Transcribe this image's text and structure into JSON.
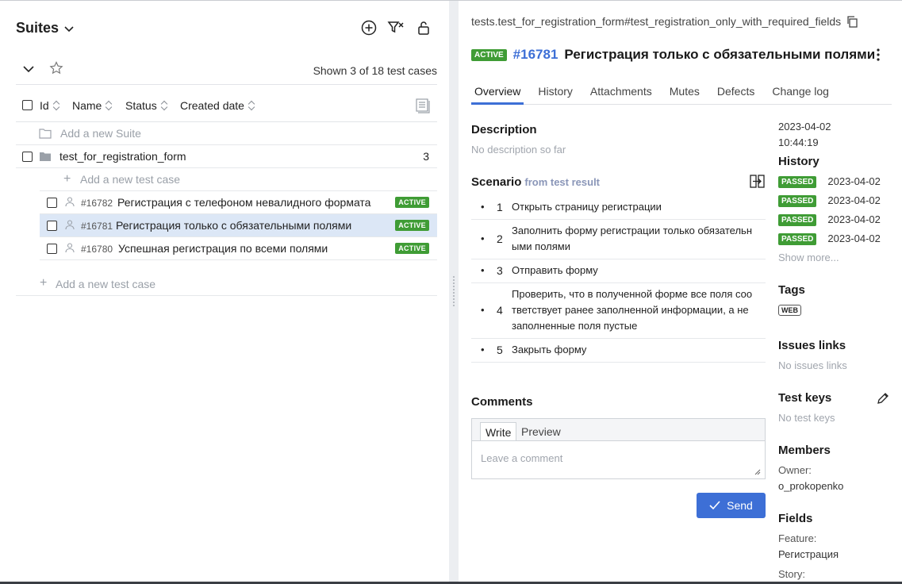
{
  "left": {
    "title": "Suites",
    "shown": "Shown 3 of 18 test cases",
    "columns": {
      "id": "Id",
      "name": "Name",
      "status": "Status",
      "created": "Created date"
    },
    "add_suite": "Add a new Suite",
    "suite": {
      "name": "test_for_registration_form",
      "count": "3"
    },
    "add_case_inner": "Add a new test case",
    "cases": [
      {
        "id": "#16782",
        "name": "Регистрация с телефоном невалидного формата",
        "status": "ACTIVE"
      },
      {
        "id": "#16781",
        "name": "Регистрация только с обязательными полями",
        "status": "ACTIVE"
      },
      {
        "id": "#16780",
        "name": "Успешная регистрация по всеми полями",
        "status": "ACTIVE"
      }
    ],
    "add_case_outer": "Add a new test case"
  },
  "right": {
    "fqn": "tests.test_for_registration_form#test_registration_only_with_required_fields",
    "status": "ACTIVE",
    "id": "#16781",
    "title": "Регистрация только с обязательными полями",
    "tabs": [
      "Overview",
      "History",
      "Attachments",
      "Mutes",
      "Defects",
      "Change log"
    ],
    "description_h": "Description",
    "description": "No description so far",
    "scenario_h": "Scenario",
    "scenario_sub": "from test result",
    "steps": [
      {
        "n": "1",
        "text": "Открыть страницу регистрации"
      },
      {
        "n": "2",
        "text": "Заполнить форму регистрации только обязательн ыми полями"
      },
      {
        "n": "3",
        "text": "Отправить форму"
      },
      {
        "n": "4",
        "text": "Проверить, что в полученной форме все поля соо тветствует ранее заполненной информации, а не заполненные поля пустые"
      },
      {
        "n": "5",
        "text": "Закрыть форму"
      }
    ],
    "comments_h": "Comments",
    "write_tab": "Write",
    "preview_tab": "Preview",
    "comment_placeholder": "Leave a comment",
    "send": "Send",
    "side": {
      "created_date": "2023-04-02",
      "created_time": "10:44:19",
      "history_h": "History",
      "history": [
        {
          "status": "PASSED",
          "date": "2023-04-02"
        },
        {
          "status": "PASSED",
          "date": "2023-04-02"
        },
        {
          "status": "PASSED",
          "date": "2023-04-02"
        },
        {
          "status": "PASSED",
          "date": "2023-04-02"
        }
      ],
      "show_more": "Show more...",
      "tags_h": "Tags",
      "tag": "WEB",
      "issues_h": "Issues links",
      "issues": "No issues links",
      "keys_h": "Test keys",
      "keys": "No test keys",
      "members_h": "Members",
      "owner_label": "Owner:",
      "owner": "o_prokopenko",
      "fields_h": "Fields",
      "feature_label": "Feature:",
      "feature": "Регистрация",
      "story_label": "Story:"
    }
  },
  "colors": {
    "accent": "#3d6fd6",
    "active_badge": "#3f9c35",
    "selected_row": "#dce7f6"
  }
}
